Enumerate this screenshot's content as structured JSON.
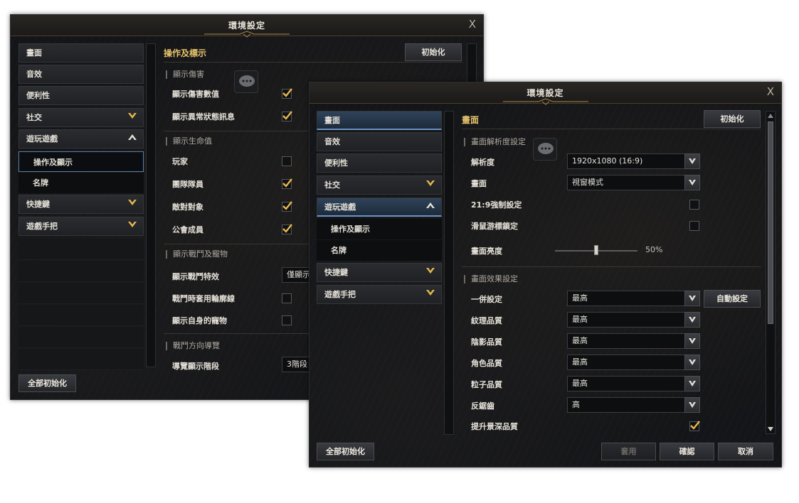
{
  "back_window": {
    "title": "環境設定",
    "close": "X",
    "sidebar": {
      "items": [
        {
          "label": "畫面"
        },
        {
          "label": "音效"
        },
        {
          "label": "便利性"
        },
        {
          "label": "社交",
          "icon": "chevron-down"
        },
        {
          "label": "遊玩遊戲",
          "icon": "chevron-up"
        }
      ],
      "sub_items": [
        {
          "label": "操作及顯示",
          "selected": true
        },
        {
          "label": "名牌"
        }
      ],
      "items_after": [
        {
          "label": "快捷鍵",
          "icon": "chevron-down"
        },
        {
          "label": "遊戲手把",
          "icon": "chevron-down"
        }
      ]
    },
    "content": {
      "header": "操作及標示",
      "init_button": "初始化",
      "sections": [
        {
          "title": "顯示傷害",
          "rows": [
            {
              "label": "顯示傷害數值",
              "checked": true
            },
            {
              "label": "顯示異常狀態訊息",
              "checked": true
            }
          ]
        },
        {
          "title": "顯示生命值",
          "rows": [
            {
              "label": "玩家",
              "checked": false
            },
            {
              "label": "團隊隊員",
              "checked": true
            },
            {
              "label": "敵對對象",
              "checked": true
            },
            {
              "label": "公會成員",
              "checked": true
            }
          ]
        },
        {
          "title": "顯示戰鬥及寵物",
          "rows": [
            {
              "label": "顯示戰鬥特效",
              "dropdown": "僅顯示"
            },
            {
              "label": "戰鬥時套用輪廓線",
              "checked": false
            },
            {
              "label": "顯示自身的寵物",
              "checked": false
            }
          ]
        },
        {
          "title": "戰鬥方向導覽",
          "rows": [
            {
              "label": "導覽顯示階段",
              "dropdown": "3階段"
            }
          ]
        }
      ],
      "chat_label": "對話"
    },
    "reset_all_button": "全部初始化"
  },
  "front_window": {
    "title": "環境設定",
    "close": "X",
    "sidebar": {
      "items": [
        {
          "label": "畫面",
          "selected": true
        },
        {
          "label": "音效"
        },
        {
          "label": "便利性"
        },
        {
          "label": "社交",
          "icon": "chevron-down"
        },
        {
          "label": "遊玩遊戲",
          "icon": "chevron-up"
        }
      ],
      "sub_items": [
        {
          "label": "操作及顯示"
        },
        {
          "label": "名牌"
        }
      ],
      "items_after": [
        {
          "label": "快捷鍵",
          "icon": "chevron-down"
        },
        {
          "label": "遊戲手把",
          "icon": "chevron-down"
        }
      ]
    },
    "content": {
      "header": "畫面",
      "init_button": "初始化",
      "resolution_section": {
        "title": "畫面解析度設定",
        "resolution_label": "解析度",
        "resolution_value": "1920x1080 (16:9)",
        "screen_label": "畫面",
        "screen_value": "視窗模式",
        "ratio_label": "21:9強制設定",
        "ratio_checked": false,
        "mouse_lock_label": "滑鼠游標鎖定",
        "mouse_lock_checked": false,
        "brightness_label": "畫面亮度",
        "brightness_value": "50%",
        "brightness_level": 0.5
      },
      "effects_section": {
        "title": "畫面效果設定",
        "auto_button": "自動設定",
        "rows": [
          {
            "label": "一併設定",
            "value": "最高"
          },
          {
            "label": "紋理品質",
            "value": "最高"
          },
          {
            "label": "陰影品質",
            "value": "最高"
          },
          {
            "label": "角色品質",
            "value": "最高"
          },
          {
            "label": "粒子品質",
            "value": "最高"
          },
          {
            "label": "反鋸齒",
            "value": "高"
          }
        ],
        "depth_label": "提升景深品質",
        "depth_checked": true
      },
      "chat_label": "對話"
    },
    "reset_all_button": "全部初始化",
    "apply_button": "套用",
    "confirm_button": "確認",
    "cancel_button": "取消"
  },
  "colors": {
    "accent_gold": "#e6c36d",
    "selection_blue": "#6b94c6"
  }
}
